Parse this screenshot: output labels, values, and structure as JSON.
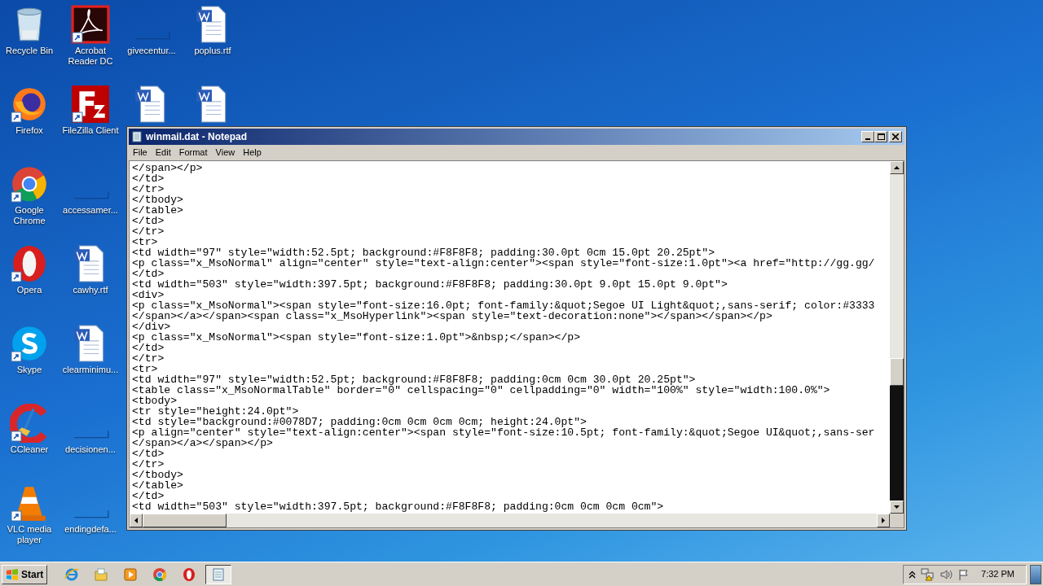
{
  "desktop_columns": [
    [
      {
        "label": "Recycle Bin",
        "kind": "recycle",
        "shortcut": false
      },
      {
        "label": "Firefox",
        "kind": "firefox",
        "shortcut": true
      },
      {
        "label": "Google Chrome",
        "kind": "chrome",
        "shortcut": true
      },
      {
        "label": "Opera",
        "kind": "opera",
        "shortcut": true
      },
      {
        "label": "Skype",
        "kind": "skype",
        "shortcut": true
      },
      {
        "label": "CCleaner",
        "kind": "ccleaner",
        "shortcut": true
      },
      {
        "label": "VLC media player",
        "kind": "vlc",
        "shortcut": true
      }
    ],
    [
      {
        "label": "Acrobat Reader DC",
        "kind": "acrobat",
        "shortcut": true
      },
      {
        "label": "FileZilla Client",
        "kind": "filezilla",
        "shortcut": true
      },
      {
        "label": "accessamer...",
        "kind": "blank",
        "shortcut": false
      },
      {
        "label": "cawhy.rtf",
        "kind": "document",
        "shortcut": false
      },
      {
        "label": "clearminimu...",
        "kind": "document",
        "shortcut": false
      },
      {
        "label": "decisionen...",
        "kind": "blank",
        "shortcut": false
      },
      {
        "label": "endingdefa...",
        "kind": "blank",
        "shortcut": false
      }
    ],
    [
      {
        "label": "givecentur...",
        "kind": "blank",
        "shortcut": false
      },
      {
        "kind": "document",
        "shortcut": false
      }
    ],
    [
      {
        "label": "poplus.rtf",
        "kind": "document",
        "shortcut": false
      },
      {
        "kind": "document",
        "shortcut": false
      }
    ]
  ],
  "window": {
    "title": "winmail.dat - Notepad",
    "menu": [
      "File",
      "Edit",
      "Format",
      "View",
      "Help"
    ],
    "lines": [
      "</span></p>",
      "</td>",
      "</tr>",
      "</tbody>",
      "</table>",
      "</td>",
      "</tr>",
      "<tr>",
      "<td width=\"97\" style=\"width:52.5pt; background:#F8F8F8; padding:30.0pt 0cm 15.0pt 20.25pt\">",
      "<p class=\"x_MsoNormal\" align=\"center\" style=\"text-align:center\"><span style=\"font-size:1.0pt\"><a href=\"http://gg.gg/",
      "</td>",
      "<td width=\"503\" style=\"width:397.5pt; background:#F8F8F8; padding:30.0pt 9.0pt 15.0pt 9.0pt\">",
      "<div>",
      "<p class=\"x_MsoNormal\"><span style=\"font-size:16.0pt; font-family:&quot;Segoe UI Light&quot;,sans-serif; color:#3333",
      "</span></a></span><span class=\"x_MsoHyperlink\"><span style=\"text-decoration:none\"></span></span></p>",
      "</div>",
      "<p class=\"x_MsoNormal\"><span style=\"font-size:1.0pt\">&nbsp;</span></p>",
      "</td>",
      "</tr>",
      "<tr>",
      "<td width=\"97\" style=\"width:52.5pt; background:#F8F8F8; padding:0cm 0cm 30.0pt 20.25pt\">",
      "<table class=\"x_MsoNormalTable\" border=\"0\" cellspacing=\"0\" cellpadding=\"0\" width=\"100%\" style=\"width:100.0%\">",
      "<tbody>",
      "<tr style=\"height:24.0pt\">",
      "<td style=\"background:#0078D7; padding:0cm 0cm 0cm 0cm; height:24.0pt\">",
      "<p align=\"center\" style=\"text-align:center\"><span style=\"font-size:10.5pt; font-family:&quot;Segoe UI&quot;,sans-ser",
      "</span></a></span></p>",
      "</td>",
      "</tr>",
      "</tbody>",
      "</table>",
      "</td>",
      "<td width=\"503\" style=\"width:397.5pt; background:#F8F8F8; padding:0cm 0cm 0cm 0cm\">"
    ]
  },
  "taskbar": {
    "start": "Start",
    "apps": [
      {
        "kind": "ie",
        "selected": false
      },
      {
        "kind": "explorer",
        "selected": false
      },
      {
        "kind": "media",
        "selected": false
      },
      {
        "kind": "chrome",
        "selected": false
      },
      {
        "kind": "opera",
        "selected": false
      },
      {
        "kind": "notepad",
        "selected": true
      }
    ],
    "clock": "7:32 PM"
  }
}
